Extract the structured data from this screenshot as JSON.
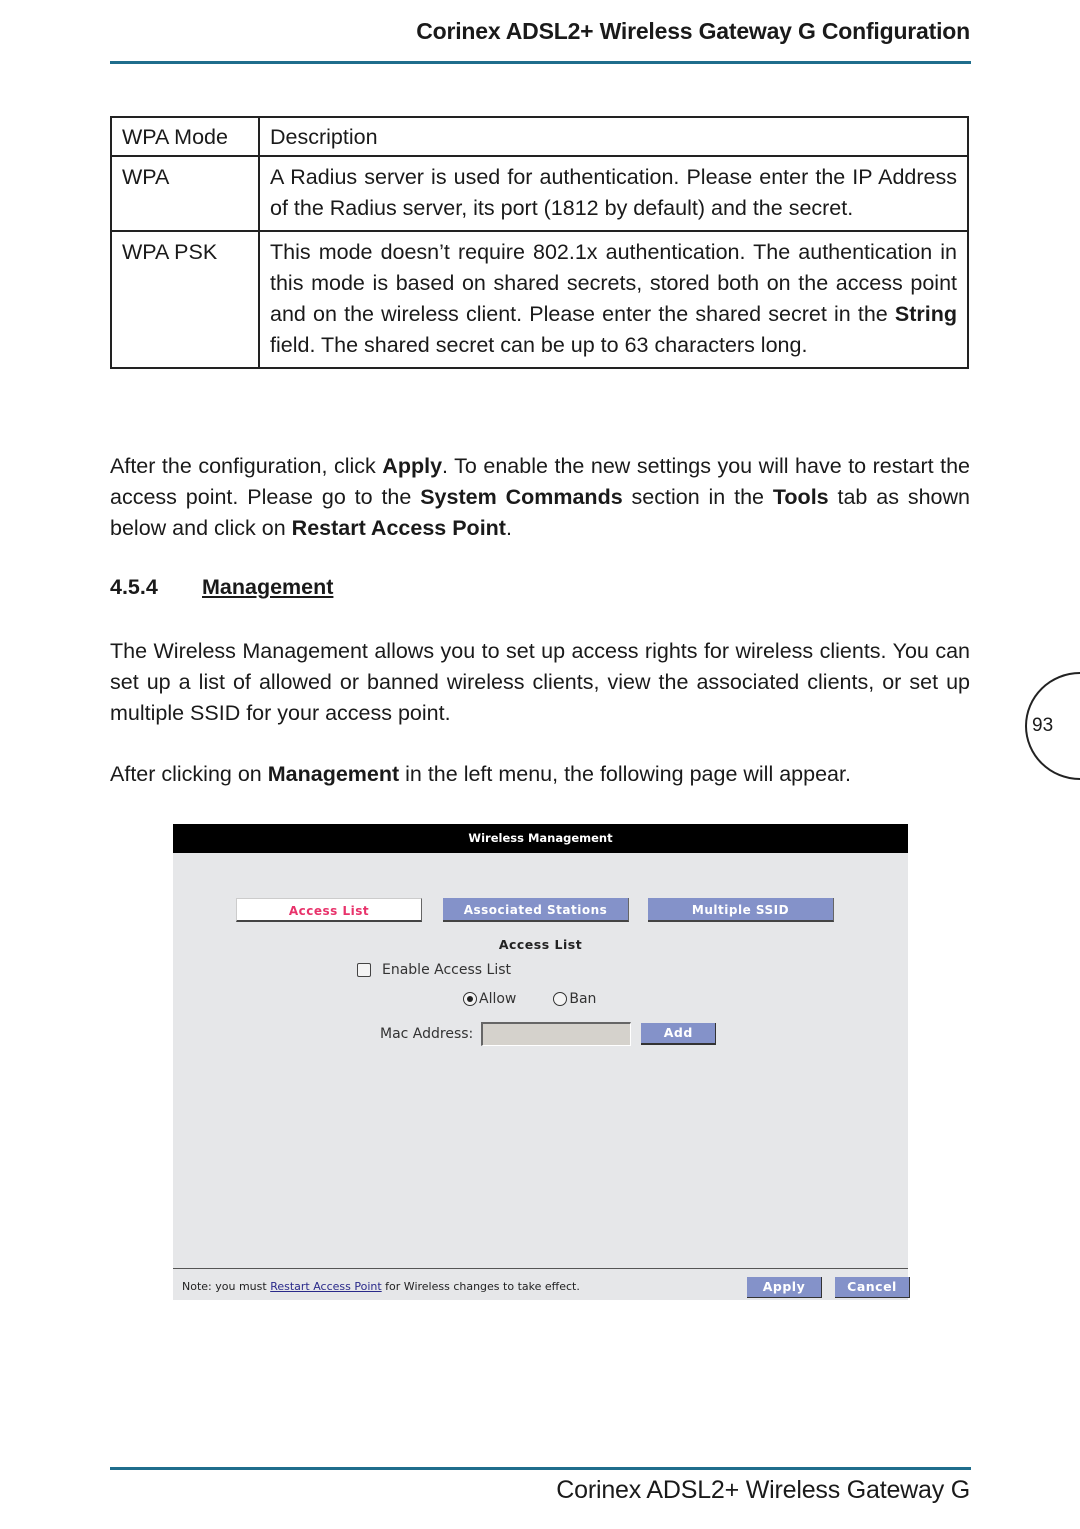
{
  "header": {
    "title": "Corinex ADSL2+ Wireless Gateway G Configuration"
  },
  "wpa_table": {
    "columns": [
      "WPA Mode",
      "Description"
    ],
    "rows": [
      {
        "mode": "WPA",
        "description": "A Radius server is used for authentication. Please enter the IP Address of the Radius server, its port (1812 by default) and the secret."
      },
      {
        "mode": "WPA PSK",
        "description_before": "This mode doesn’t require 802.1x authentication. The authentication in this mode is based on shared secrets, stored both on the access point and on the wireless client. Please enter the shared secret in the ",
        "description_bold": "String",
        "description_after": " field. The shared secret can be up to 63 characters long."
      }
    ]
  },
  "para_apply": {
    "t1": "After the configuration, click ",
    "b1": "Apply",
    "t2": ". To enable the new settings you will have to restart the access point. Please go to the ",
    "b2": "System Commands",
    "t3": " section in the ",
    "b3": "Tools",
    "t4": " tab as shown below and click on ",
    "b4": "Restart Access Point",
    "t5": "."
  },
  "section": {
    "number": "4.5.4",
    "title": "Management"
  },
  "para_intro": "The Wireless Management allows you to set up access rights for wireless clients. You can set up a list of allowed or banned wireless clients, view the associated clients, or set up multiple SSID  for your access point.",
  "para_after": {
    "t1": "After clicking on ",
    "b1": "Management",
    "t2": " in the left menu, the following page will appear."
  },
  "page_number": "93",
  "screenshot": {
    "title": "Wireless Management",
    "tabs": [
      {
        "label": "Access List",
        "active": true
      },
      {
        "label": "Associated Stations",
        "active": false
      },
      {
        "label": "Multiple SSID",
        "active": false
      }
    ],
    "section_title": "Access List",
    "enable_label": "Enable Access List",
    "enable_checked": false,
    "radio_options": [
      {
        "label": "Allow",
        "checked": true
      },
      {
        "label": "Ban",
        "checked": false
      }
    ],
    "mac_label": "Mac Address:",
    "mac_value": "",
    "add_label": "Add",
    "note_before": "Note: you must ",
    "note_link": "Restart Access Point",
    "note_after": " for Wireless changes to take effect.",
    "apply_label": "Apply",
    "cancel_label": "Cancel",
    "colors": {
      "active_tab_text": "#e8336b",
      "button_bg": "#8492c9",
      "title_bar": "#000000",
      "panel_bg": "#e6e7e9"
    }
  },
  "footer": {
    "title": "Corinex ADSL2+ Wireless Gateway G"
  },
  "colors": {
    "rule": "#1f6d8c"
  }
}
